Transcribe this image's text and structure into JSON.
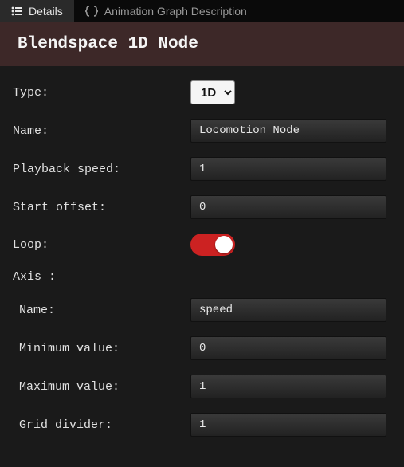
{
  "tabs": {
    "details": "Details",
    "animgraph": "Animation Graph Description"
  },
  "header": {
    "title": "Blendspace 1D Node"
  },
  "fields": {
    "type_label": "Type:",
    "type_value": "1D",
    "name_label": "Name:",
    "name_value": "Locomotion Node",
    "playback_label": "Playback speed:",
    "playback_value": "1",
    "offset_label": "Start offset:",
    "offset_value": "0",
    "loop_label": "Loop:"
  },
  "axis": {
    "section": "Axis :",
    "name_label": "Name:",
    "name_value": "speed",
    "min_label": "Minimum value:",
    "min_value": "0",
    "max_label": "Maximum value:",
    "max_value": "1",
    "grid_label": "Grid divider:",
    "grid_value": "1"
  }
}
